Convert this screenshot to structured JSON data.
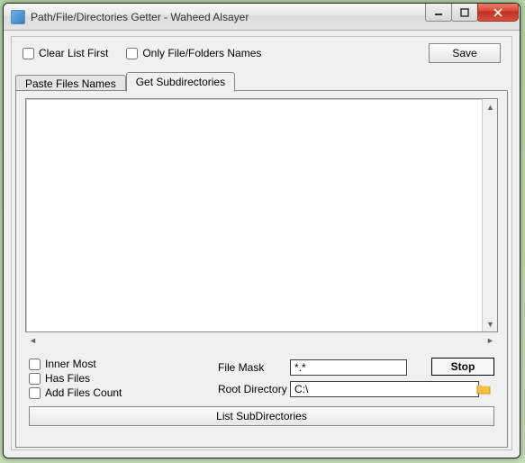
{
  "window": {
    "title": "Path/File/Directories Getter - Waheed Alsayer"
  },
  "topbar": {
    "clear_list_label": "Clear List First",
    "only_names_label": "Only File/Folders Names",
    "save_label": "Save"
  },
  "tabs": {
    "paste": "Paste Files Names",
    "subdir": "Get Subdirectories"
  },
  "options": {
    "inner_most": "Inner Most",
    "has_files": "Has Files",
    "add_count": "Add Files Count"
  },
  "fields": {
    "file_mask_label": "File Mask",
    "file_mask_value": "*.*",
    "root_dir_label": "Root Directory",
    "root_dir_value": "C:\\"
  },
  "buttons": {
    "stop": "Stop",
    "list_subdirs": "List SubDirectories"
  }
}
